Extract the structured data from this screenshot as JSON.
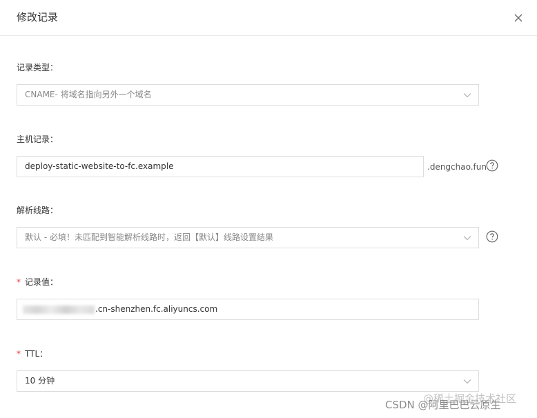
{
  "dialog": {
    "title": "修改记录"
  },
  "fields": {
    "record_type": {
      "label": "记录类型：",
      "value": "CNAME- 将域名指向另外一个域名"
    },
    "host_record": {
      "label": "主机记录：",
      "value": "deploy-static-website-to-fc.example",
      "suffix": ".dengchao.fun"
    },
    "resolution_line": {
      "label": "解析线路：",
      "value": "默认 - 必填！未匹配到智能解析线路时，返回【默认】线路设置结果"
    },
    "record_value": {
      "required_mark": "*",
      "label": "记录值：",
      "value_visible": ".cn-shenzhen.fc.aliyuncs.com"
    },
    "ttl": {
      "required_mark": "*",
      "label": "TTL：",
      "value": "10 分钟"
    }
  },
  "watermark": {
    "text1": "CSDN @阿里巴巴云原生",
    "text2": "@稀土掘金技术社区"
  },
  "colors": {
    "required": "#e4393c",
    "border": "#dcdcdc"
  }
}
